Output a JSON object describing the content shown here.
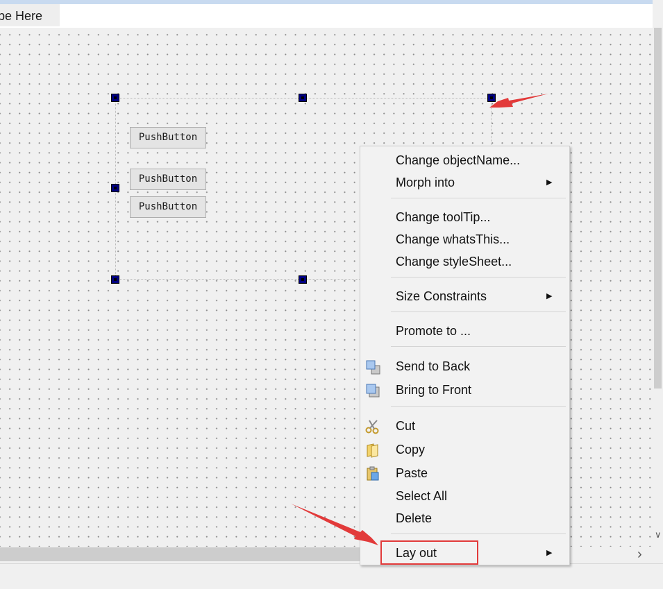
{
  "menubar": {
    "type_here": "ype Here"
  },
  "form": {
    "buttons": [
      {
        "label": "PushButton"
      },
      {
        "label": "PushButton"
      },
      {
        "label": "PushButton"
      }
    ]
  },
  "context_menu": {
    "change_object_name": "Change objectName...",
    "morph_into": "Morph into",
    "change_tooltip": "Change toolTip...",
    "change_whats_this": "Change whatsThis...",
    "change_stylesheet": "Change styleSheet...",
    "size_constraints": "Size Constraints",
    "promote_to": "Promote to ...",
    "send_to_back": "Send to Back",
    "bring_to_front": "Bring to Front",
    "cut": "Cut",
    "copy": "Copy",
    "paste": "Paste",
    "select_all": "Select All",
    "delete": "Delete",
    "lay_out": "Lay out"
  },
  "colors": {
    "handle": "#000080",
    "annotation": "#e23a3a",
    "menu_background": "#f2f2f2"
  }
}
